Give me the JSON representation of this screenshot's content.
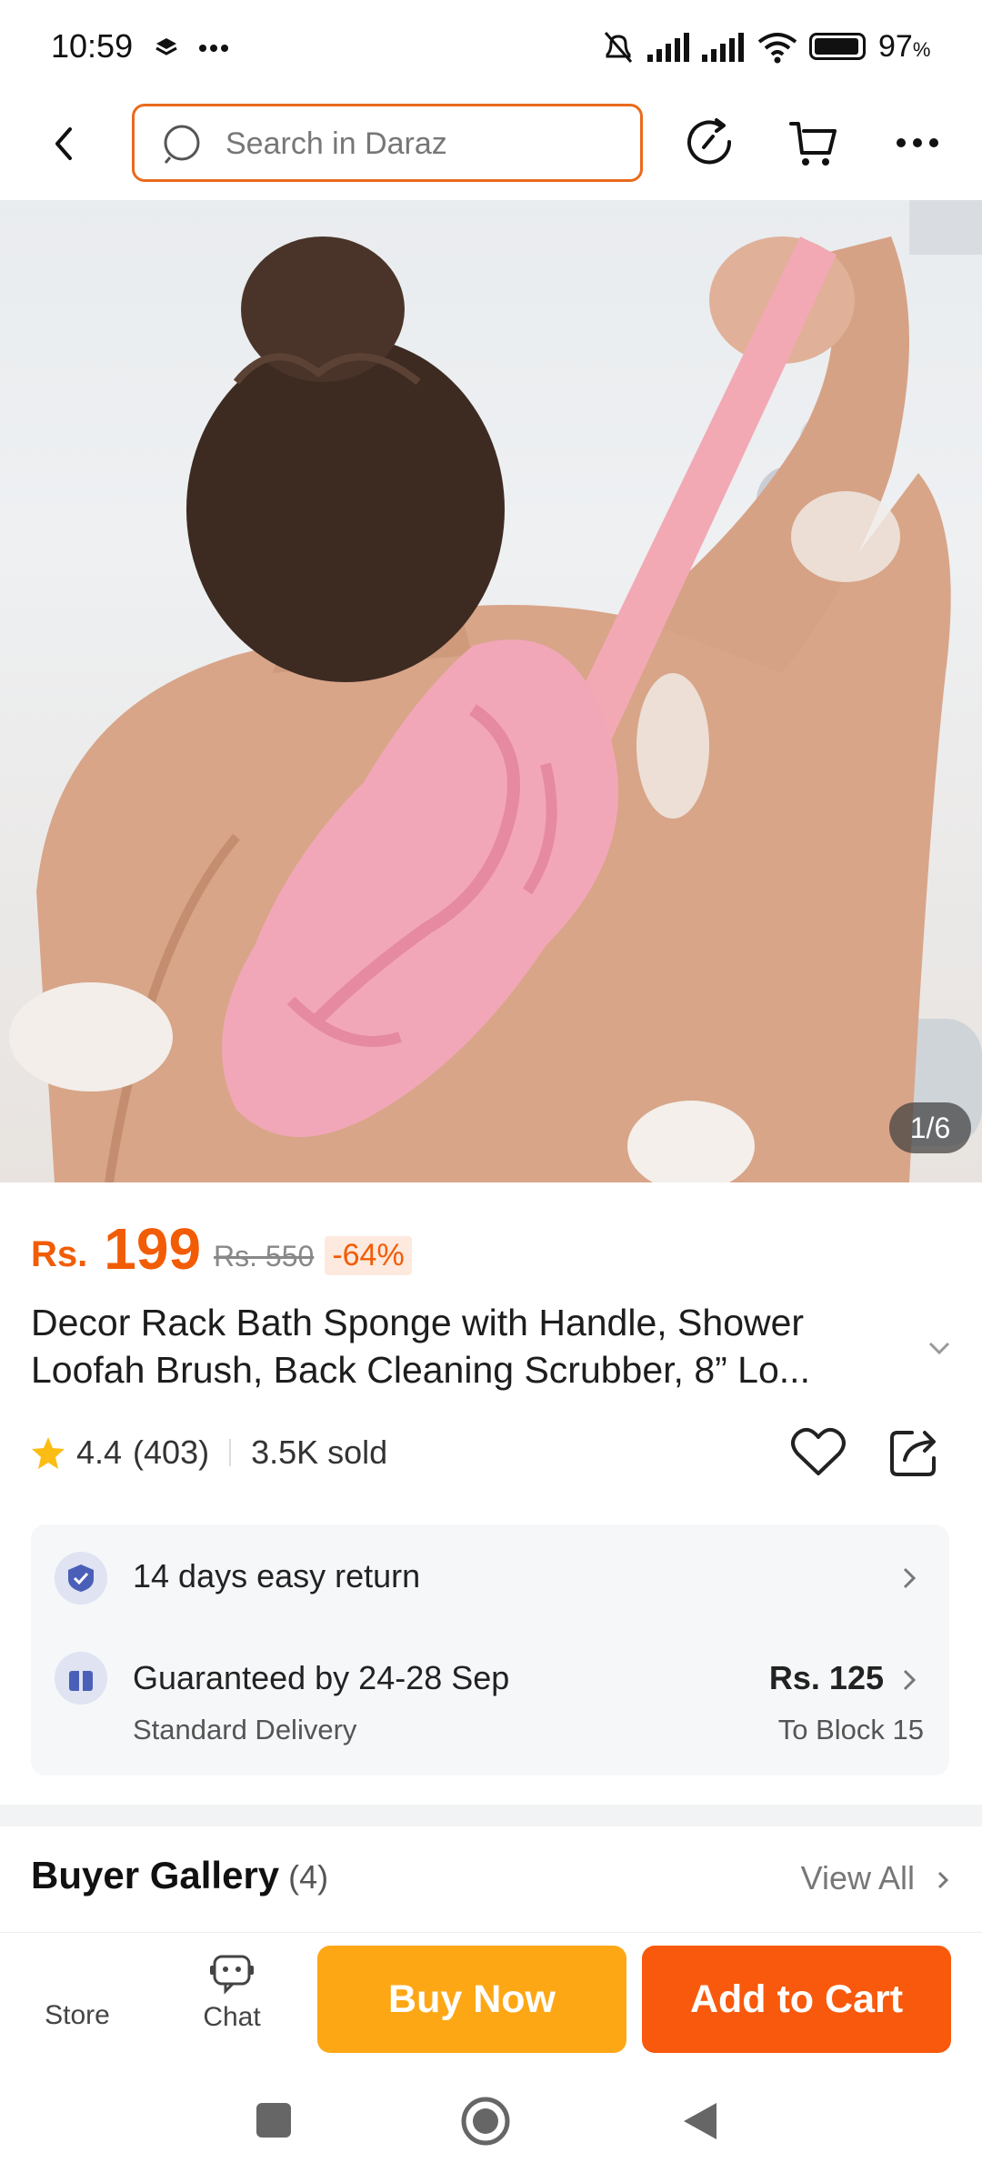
{
  "status_bar": {
    "time": "10:59",
    "battery_pct": "97",
    "battery_unit": "%"
  },
  "top_nav": {
    "search_placeholder": "Search in Daraz"
  },
  "hero": {
    "counter": "1/6"
  },
  "price": {
    "currency": "Rs.",
    "current": "199",
    "original": "Rs. 550",
    "discount": "-64%"
  },
  "product": {
    "title_line1": "Decor Rack Bath Sponge with Handle, Shower",
    "title_line2": "Loofah Brush, Back Cleaning Scrubber, 8” Lo..."
  },
  "rating": {
    "score": "4.4",
    "count": "(403)",
    "sold": "3.5K sold"
  },
  "service": {
    "return_text": "14 days easy return",
    "delivery_text": "Guaranteed by 24-28 Sep",
    "delivery_sub": "Standard Delivery",
    "delivery_price": "Rs. 125",
    "delivery_location": "To Block 15"
  },
  "gallery": {
    "title": "Buyer Gallery",
    "count": "(4)",
    "view_all": "View All"
  },
  "bottom_bar": {
    "store_label": "Store",
    "chat_label": "Chat",
    "buy_now": "Buy Now",
    "add_to_cart": "Add to Cart"
  },
  "colors": {
    "accent_orange": "#f25c05",
    "buy_now": "#fea715",
    "add_to_cart": "#f8590d",
    "search_border": "#ea6a1c"
  }
}
